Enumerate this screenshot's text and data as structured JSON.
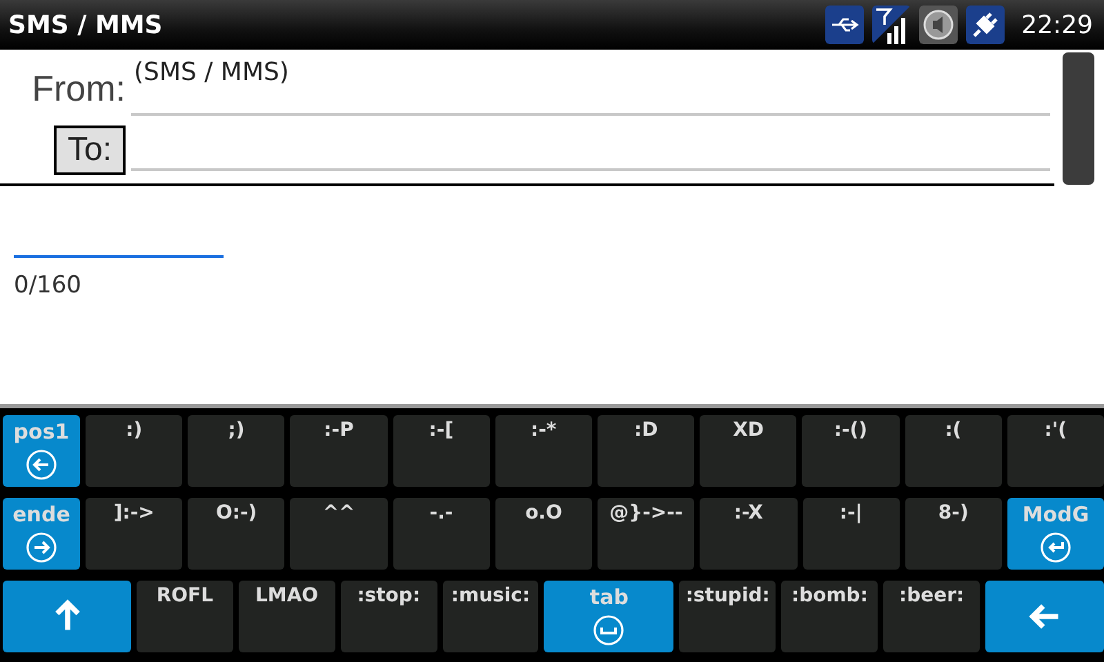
{
  "status_bar": {
    "title": "SMS / MMS",
    "time": "22:29"
  },
  "header": {
    "from_label": "From:",
    "from_value": "(SMS / MMS)",
    "to_button": "To:"
  },
  "message": {
    "counter": "0/160"
  },
  "keyboard": {
    "rows": [
      {
        "keys": [
          {
            "kind": "home",
            "label": "pos1"
          },
          {
            "kind": "text",
            "label": ":)"
          },
          {
            "kind": "text",
            "label": ";)"
          },
          {
            "kind": "text",
            "label": ":-P"
          },
          {
            "kind": "text",
            "label": ":-["
          },
          {
            "kind": "text",
            "label": ":-*"
          },
          {
            "kind": "text",
            "label": ":D"
          },
          {
            "kind": "text",
            "label": "XD"
          },
          {
            "kind": "text",
            "label": ":-()"
          },
          {
            "kind": "text",
            "label": ":("
          },
          {
            "kind": "text",
            "label": ":'("
          }
        ]
      },
      {
        "keys": [
          {
            "kind": "end",
            "label": "ende"
          },
          {
            "kind": "text",
            "label": "]:->"
          },
          {
            "kind": "text",
            "label": "O:-)"
          },
          {
            "kind": "text",
            "label": "^^"
          },
          {
            "kind": "text",
            "label": "-.-"
          },
          {
            "kind": "text",
            "label": "o.O"
          },
          {
            "kind": "text",
            "label": "@}->--"
          },
          {
            "kind": "text",
            "label": ":-X"
          },
          {
            "kind": "text",
            "label": ":-|"
          },
          {
            "kind": "text",
            "label": "8-)"
          },
          {
            "kind": "modifier",
            "label": "ModG"
          }
        ]
      },
      {
        "keys": [
          {
            "kind": "shift"
          },
          {
            "kind": "text",
            "label": "ROFL"
          },
          {
            "kind": "text",
            "label": "LMAO"
          },
          {
            "kind": "text",
            "label": ":stop:"
          },
          {
            "kind": "text",
            "label": ":music:"
          },
          {
            "kind": "tab",
            "label": "tab"
          },
          {
            "kind": "text",
            "label": ":stupid:"
          },
          {
            "kind": "text",
            "label": ":bomb:"
          },
          {
            "kind": "text",
            "label": ":beer:"
          },
          {
            "kind": "backspace"
          }
        ]
      }
    ]
  }
}
